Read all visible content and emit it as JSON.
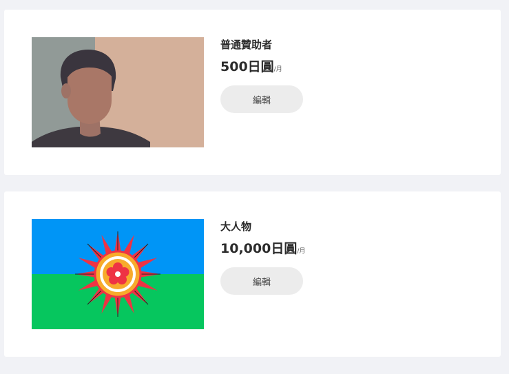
{
  "tiers": [
    {
      "name": "普通贊助者",
      "price": "500日圓",
      "period": "/月",
      "edit_label": "編輯",
      "image": "avatar-portrait"
    },
    {
      "name": "大人物",
      "price": "10,000日圓",
      "period": "/月",
      "edit_label": "編輯",
      "image": "romani-flag"
    }
  ],
  "colors": {
    "page_background": "#f1f2f6",
    "card_background": "#ffffff",
    "button_background": "#ececec",
    "text_primary": "#2b2b2b"
  }
}
